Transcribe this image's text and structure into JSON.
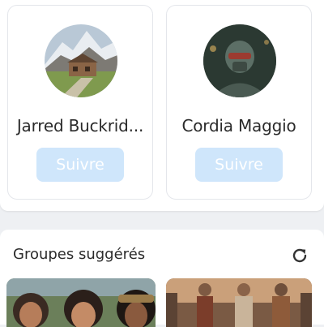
{
  "suggested_people": [
    {
      "name": "Jarred Buckrid...",
      "follow_label": "Suivre",
      "avatar": "mountain-cabin-landscape"
    },
    {
      "name": "Cordia Maggio",
      "follow_label": "Suivre",
      "avatar": "armored-helmet-figure"
    }
  ],
  "suggested_groups": {
    "title": "Groupes suggérés",
    "refresh_icon": "refresh-icon",
    "groups": [
      {
        "image": "group-of-women-portrait"
      },
      {
        "image": "period-costume-group"
      }
    ]
  },
  "colors": {
    "follow_button_bg": "#cfe6fb",
    "follow_button_text": "#ffffff",
    "page_bg": "#eef0f3"
  }
}
